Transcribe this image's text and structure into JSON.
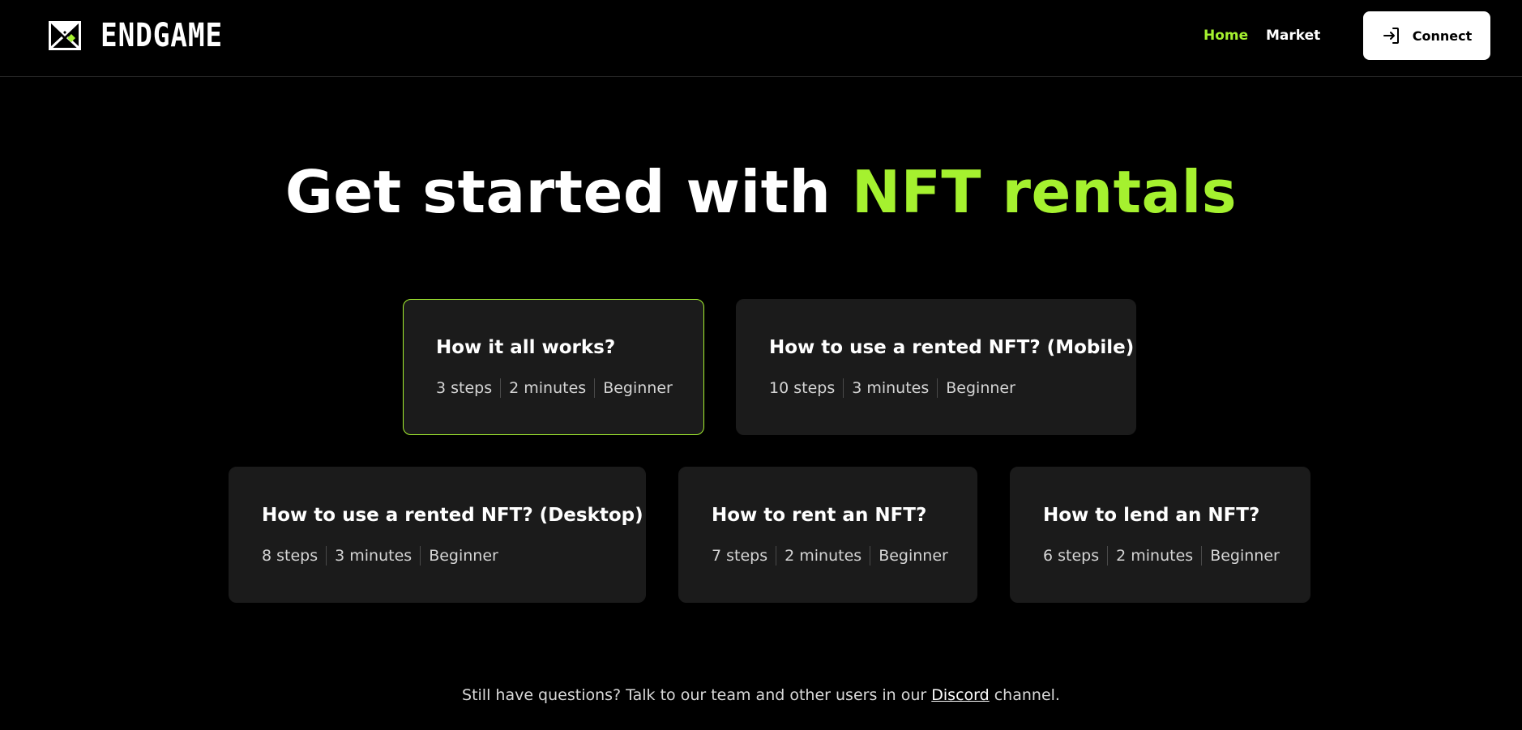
{
  "brand": {
    "logo_icon": "envelope-diamond-logo-icon",
    "name": "ENDGAME",
    "accent_color": "#a5f12f",
    "background_color": "#000000",
    "card_color": "#1b1b1b"
  },
  "nav": {
    "items": [
      {
        "label": "Home",
        "active": true
      },
      {
        "label": "Market",
        "active": false
      }
    ],
    "connect": {
      "icon": "sign-in-arrow-icon",
      "label": "Connect"
    }
  },
  "hero": {
    "title_prefix": "Get started with",
    "title_accent": "NFT rentals"
  },
  "cards": [
    {
      "title": "How it all works?",
      "steps": "3 steps",
      "duration": "2 minutes",
      "level": "Beginner",
      "active": true
    },
    {
      "title": "How to use a rented NFT? (Mobile)",
      "steps": "10 steps",
      "duration": "3 minutes",
      "level": "Beginner",
      "active": false
    },
    {
      "title": "How to use a rented NFT? (Desktop)",
      "steps": "8 steps",
      "duration": "3 minutes",
      "level": "Beginner",
      "active": false
    },
    {
      "title": "How to rent an NFT?",
      "steps": "7 steps",
      "duration": "2 minutes",
      "level": "Beginner",
      "active": false
    },
    {
      "title": "How to lend an NFT?",
      "steps": "6 steps",
      "duration": "2 minutes",
      "level": "Beginner",
      "active": false
    }
  ],
  "footer": {
    "text_before": "Still have questions? Talk to our team and other users in our",
    "link": "Discord",
    "text_after": "channel."
  }
}
